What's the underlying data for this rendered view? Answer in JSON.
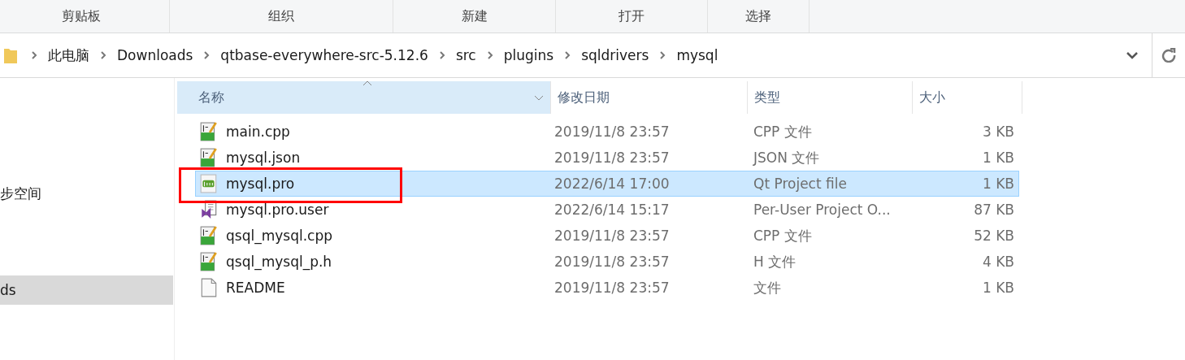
{
  "ribbon_groups": [
    "剪贴板",
    "组织",
    "新建",
    "打开",
    "选择"
  ],
  "address_bar": {
    "crumbs": [
      "此电脑",
      "Downloads",
      "qtbase-everywhere-src-5.12.6",
      "src",
      "plugins",
      "sqldrivers",
      "mysql"
    ]
  },
  "sidebar": {
    "items": [
      {
        "label": "步空间",
        "selected": false
      },
      {
        "label": "ds",
        "selected": true
      }
    ]
  },
  "table": {
    "columns": [
      {
        "label": "名称",
        "sorted": true
      },
      {
        "label": "修改日期",
        "sorted": false
      },
      {
        "label": "类型",
        "sorted": false
      },
      {
        "label": "大小",
        "sorted": false
      }
    ],
    "rows": [
      {
        "kind": "source",
        "name": "main.cpp",
        "date": "2019/11/8 23:57",
        "type": "CPP 文件",
        "size": "3 KB",
        "selected": false,
        "highlighted": false
      },
      {
        "kind": "source",
        "name": "mysql.json",
        "date": "2019/11/8 23:57",
        "type": "JSON 文件",
        "size": "1 KB",
        "selected": false,
        "highlighted": false
      },
      {
        "kind": "project",
        "name": "mysql.pro",
        "date": "2022/6/14 17:00",
        "type": "Qt Project file",
        "size": "1 KB",
        "selected": true,
        "highlighted": true
      },
      {
        "kind": "vs",
        "name": "mysql.pro.user",
        "date": "2022/6/14 15:17",
        "type": "Per-User Project O...",
        "size": "87 KB",
        "selected": false,
        "highlighted": false
      },
      {
        "kind": "source",
        "name": "qsql_mysql.cpp",
        "date": "2019/11/8 23:57",
        "type": "CPP 文件",
        "size": "52 KB",
        "selected": false,
        "highlighted": false
      },
      {
        "kind": "source",
        "name": "qsql_mysql_p.h",
        "date": "2019/11/8 23:57",
        "type": "H 文件",
        "size": "4 KB",
        "selected": false,
        "highlighted": false
      },
      {
        "kind": "text",
        "name": "README",
        "date": "2019/11/8 23:57",
        "type": "文件",
        "size": "1 KB",
        "selected": false,
        "highlighted": false
      }
    ]
  }
}
